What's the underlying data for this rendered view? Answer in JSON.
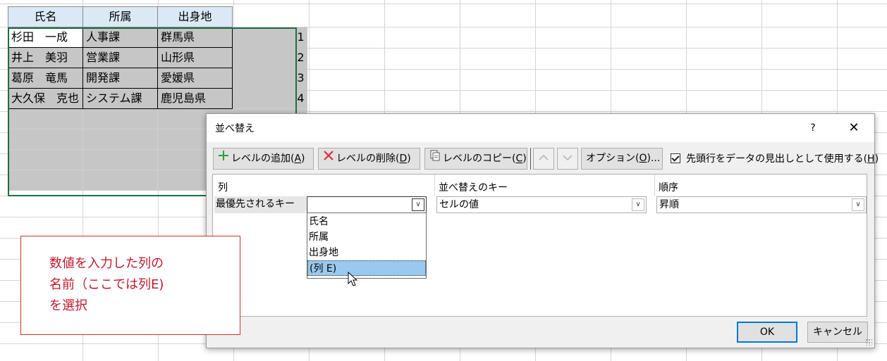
{
  "sheet": {
    "headers": [
      "氏名",
      "所属",
      "出身地"
    ],
    "rows": [
      {
        "name": "杉田　一成",
        "dept": "人事課",
        "origin": "群馬県",
        "num": "1"
      },
      {
        "name": "井上　美羽",
        "dept": "営業課",
        "origin": "山形県",
        "num": "2"
      },
      {
        "name": "葛原　竜馬",
        "dept": "開発課",
        "origin": "愛媛県",
        "num": "3"
      },
      {
        "name": "大久保　克也",
        "dept": "システム課",
        "origin": "鹿児島県",
        "num": "4"
      }
    ]
  },
  "dialog": {
    "title": "並べ替え",
    "help": "?",
    "close": "✕",
    "toolbar": {
      "add_level": "レベルの追加(",
      "add_level_key": "A",
      "delete_level": "レベルの削除(",
      "delete_level_key": "D",
      "copy_level": "レベルのコピー(",
      "copy_level_key": "C",
      "options": "オプション(",
      "options_key": "O",
      "options_suffix": ")...",
      "close_paren": ")"
    },
    "header_checkbox": {
      "label": "先頭行をデータの見出しとして使用する(",
      "key": "H",
      "checked": true
    },
    "columns": {
      "col": "列",
      "sort_on": "並べ替えのキー",
      "order": "順序"
    },
    "level_row": {
      "label": "最優先されるキー",
      "column_value": "",
      "sort_on_value": "セルの値",
      "order_value": "昇順"
    },
    "dropdown_options": [
      "氏名",
      "所属",
      "出身地",
      "(列 E)"
    ],
    "highlighted_option_index": 3,
    "ok": "OK",
    "cancel": "キャンセル"
  },
  "callout": {
    "lines": [
      "数値を入力した列の",
      "名前（ここでは列E)",
      "を選択"
    ],
    "color": "#c0192b"
  },
  "colors": {
    "header_fill": "#dbe9f6",
    "selection_fill": "#c6c6c6",
    "selection_border": "#1e6e42",
    "highlight": "#99c9ef",
    "ok_border": "#0078d7"
  }
}
